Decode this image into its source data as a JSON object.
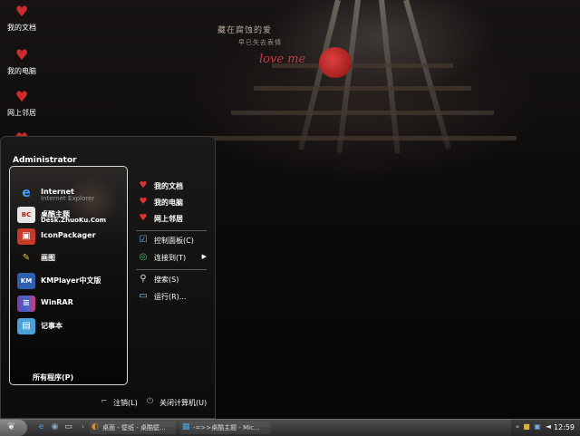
{
  "desktop": {
    "wallpaper": {
      "line1": "藏在腐蚀的爱",
      "line2": "早已失去表情",
      "love": "love me"
    },
    "icons": [
      {
        "label": "我的文档",
        "icon": "folder-heart-icon"
      },
      {
        "label": "我的电脑",
        "icon": "computer-heart-icon"
      },
      {
        "label": "网上邻居",
        "icon": "network-heart-icon"
      }
    ]
  },
  "start_menu": {
    "user_name": "Administrator",
    "programs": [
      {
        "label": "Internet",
        "sublabel": "Internet Explorer",
        "icon": "ie-icon"
      },
      {
        "label": "桌酷主题",
        "sublabel": "Desk.ZhuoKu.Com",
        "icon": "zhuoku-icon"
      },
      {
        "label": "IconPackager",
        "icon": "iconpackager-icon"
      },
      {
        "label": "画图",
        "icon": "paint-icon"
      },
      {
        "label": "KMPlayer中文版",
        "icon": "kmplayer-icon"
      },
      {
        "label": "WinRAR",
        "icon": "winrar-icon"
      },
      {
        "label": "记事本",
        "icon": "notepad-icon"
      }
    ],
    "all_programs": "所有程序(P)",
    "places": [
      {
        "label": "我的文档",
        "icon": "documents-heart-icon"
      },
      {
        "label": "我的电脑",
        "icon": "computer-heart-icon"
      },
      {
        "label": "网上邻居",
        "icon": "network-heart-icon"
      }
    ],
    "system": [
      {
        "label": "控制面板(C)",
        "icon": "control-panel-icon"
      },
      {
        "label": "连接到(T)",
        "icon": "connect-icon",
        "submenu": true
      }
    ],
    "tools": [
      {
        "label": "搜索(S)",
        "icon": "search-icon"
      },
      {
        "label": "运行(R)...",
        "icon": "run-icon"
      }
    ],
    "logoff": "注销(L)",
    "shutdown": "关闭计算机(U)"
  },
  "taskbar": {
    "tasks": [
      {
        "label": "桌面 - 壁纸 - 桌酷壁...",
        "icon": "browser-icon"
      },
      {
        "label": "-=>>桌酷主题 - Mic...",
        "icon": "ie-window-icon"
      }
    ],
    "clock": "12:59"
  }
}
